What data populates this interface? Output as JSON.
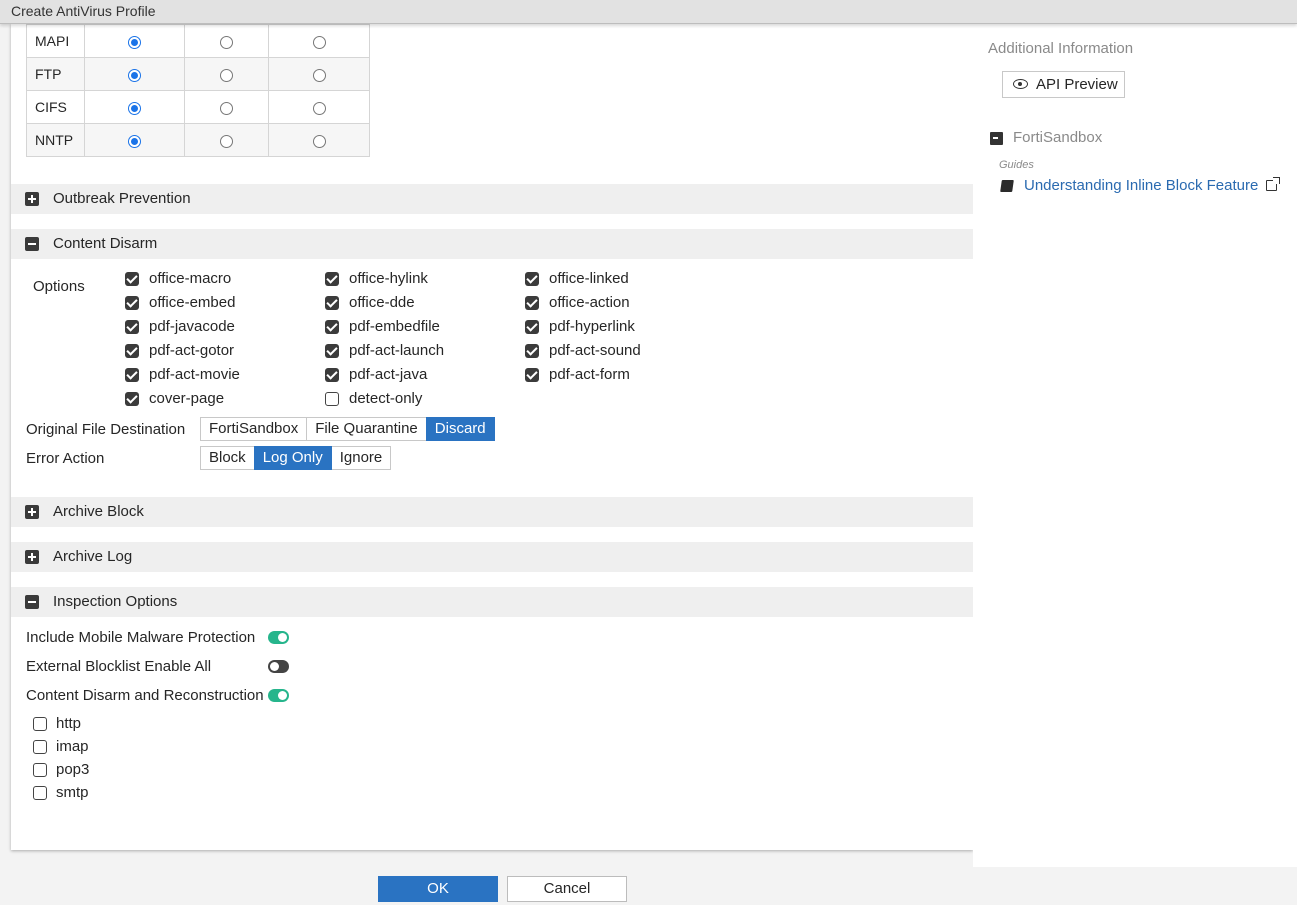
{
  "window": {
    "title": "Create AntiVirus Profile"
  },
  "protocols": [
    {
      "name": "MAPI",
      "selected": 1
    },
    {
      "name": "FTP",
      "selected": 1
    },
    {
      "name": "CIFS",
      "selected": 1
    },
    {
      "name": "NNTP",
      "selected": 1
    }
  ],
  "sections": {
    "outbreak": {
      "label": "Outbreak Prevention",
      "expanded": false
    },
    "content_disarm": {
      "label": "Content Disarm",
      "expanded": true
    },
    "archive_block": {
      "label": "Archive Block",
      "expanded": false
    },
    "archive_log": {
      "label": "Archive Log",
      "expanded": false
    },
    "inspection": {
      "label": "Inspection Options",
      "expanded": true
    }
  },
  "content_disarm": {
    "options_label": "Options",
    "options": [
      {
        "label": "office-macro",
        "checked": true
      },
      {
        "label": "office-hylink",
        "checked": true
      },
      {
        "label": "office-linked",
        "checked": true
      },
      {
        "label": "office-embed",
        "checked": true
      },
      {
        "label": "office-dde",
        "checked": true
      },
      {
        "label": "office-action",
        "checked": true
      },
      {
        "label": "pdf-javacode",
        "checked": true
      },
      {
        "label": "pdf-embedfile",
        "checked": true
      },
      {
        "label": "pdf-hyperlink",
        "checked": true
      },
      {
        "label": "pdf-act-gotor",
        "checked": true
      },
      {
        "label": "pdf-act-launch",
        "checked": true
      },
      {
        "label": "pdf-act-sound",
        "checked": true
      },
      {
        "label": "pdf-act-movie",
        "checked": true
      },
      {
        "label": "pdf-act-java",
        "checked": true
      },
      {
        "label": "pdf-act-form",
        "checked": true
      },
      {
        "label": "cover-page",
        "checked": true
      },
      {
        "label": "detect-only",
        "checked": false
      }
    ],
    "original_dest": {
      "label": "Original File Destination",
      "choices": [
        "FortiSandbox",
        "File Quarantine",
        "Discard"
      ],
      "selected": "Discard"
    },
    "error_action": {
      "label": "Error Action",
      "choices": [
        "Block",
        "Log Only",
        "Ignore"
      ],
      "selected": "Log Only"
    }
  },
  "inspection": {
    "mobile_malware": {
      "label": "Include Mobile Malware Protection",
      "on": true
    },
    "external_blocklist": {
      "label": "External Blocklist Enable All",
      "on": false
    },
    "cdr": {
      "label": "Content Disarm and Reconstruction",
      "on": true
    },
    "cdr_protocols": [
      {
        "label": "http",
        "checked": false
      },
      {
        "label": "imap",
        "checked": false
      },
      {
        "label": "pop3",
        "checked": false
      },
      {
        "label": "smtp",
        "checked": false
      }
    ]
  },
  "footer": {
    "ok_label": "OK",
    "cancel_label": "Cancel"
  },
  "sidebar": {
    "heading": "Additional Information",
    "api_preview_label": "API Preview",
    "fortisandbox_label": "FortiSandbox",
    "guides_label": "Guides",
    "guide_link": "Understanding Inline Block Feature"
  },
  "colors": {
    "primary": "#2a73c2",
    "toggle_on": "#26b58c",
    "radio_on": "#1a73e8"
  }
}
